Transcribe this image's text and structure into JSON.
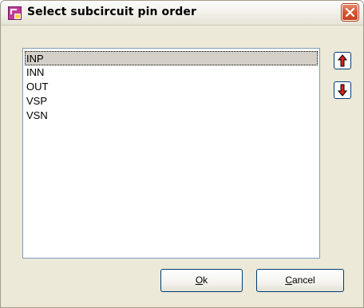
{
  "window": {
    "title": "Select subcircuit pin order",
    "app_icon": "schematic-app-icon",
    "close_icon": "close-x-icon",
    "colors": {
      "face": "#ece9d8",
      "close_button": "#d6572f",
      "list_selection": "#d4d0c8",
      "arrow_red": "#e0201e",
      "button_border": "#003c74"
    }
  },
  "pins": {
    "items": [
      "INP",
      "INN",
      "OUT",
      "VSP",
      "VSN"
    ],
    "selected": "INP"
  },
  "controls": {
    "move_up_icon": "arrow-up-icon",
    "move_down_icon": "arrow-down-icon"
  },
  "buttons": {
    "ok": {
      "mnemonic": "O",
      "rest": "k"
    },
    "cancel": {
      "mnemonic": "C",
      "rest": "ancel"
    }
  }
}
